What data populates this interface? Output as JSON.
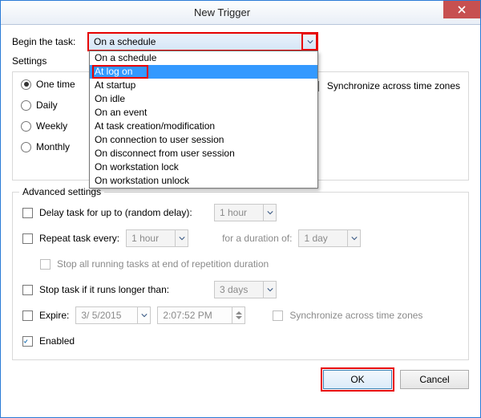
{
  "window": {
    "title": "New Trigger"
  },
  "labels": {
    "begin": "Begin the task:",
    "settings": "Settings",
    "advanced": "Advanced settings",
    "sync_tz": "Synchronize across time zones",
    "delay": "Delay task for up to (random delay):",
    "repeat": "Repeat task every:",
    "for_duration": "for a duration of:",
    "stop_running": "Stop all running tasks at end of repetition duration",
    "stop_longer": "Stop task if it runs longer than:",
    "expire": "Expire:",
    "sync_tz2": "Synchronize across time zones",
    "enabled": "Enabled",
    "ok": "OK",
    "cancel": "Cancel"
  },
  "begin_task": {
    "selected": "On a schedule",
    "options": [
      "On a schedule",
      "At log on",
      "At startup",
      "On idle",
      "On an event",
      "At task creation/modification",
      "On connection to user session",
      "On disconnect from user session",
      "On workstation lock",
      "On workstation unlock"
    ],
    "highlighted_index": 1
  },
  "schedule": {
    "radios": {
      "one_time": "One time",
      "daily": "Daily",
      "weekly": "Weekly",
      "monthly": "Monthly"
    },
    "selected": "one_time"
  },
  "advanced": {
    "delay_value": "1 hour",
    "repeat_value": "1 hour",
    "duration_value": "1 day",
    "stop_longer_value": "3 days",
    "expire_date": "3/ 5/2015",
    "expire_time": "2:07:52 PM",
    "enabled_checked": true
  }
}
